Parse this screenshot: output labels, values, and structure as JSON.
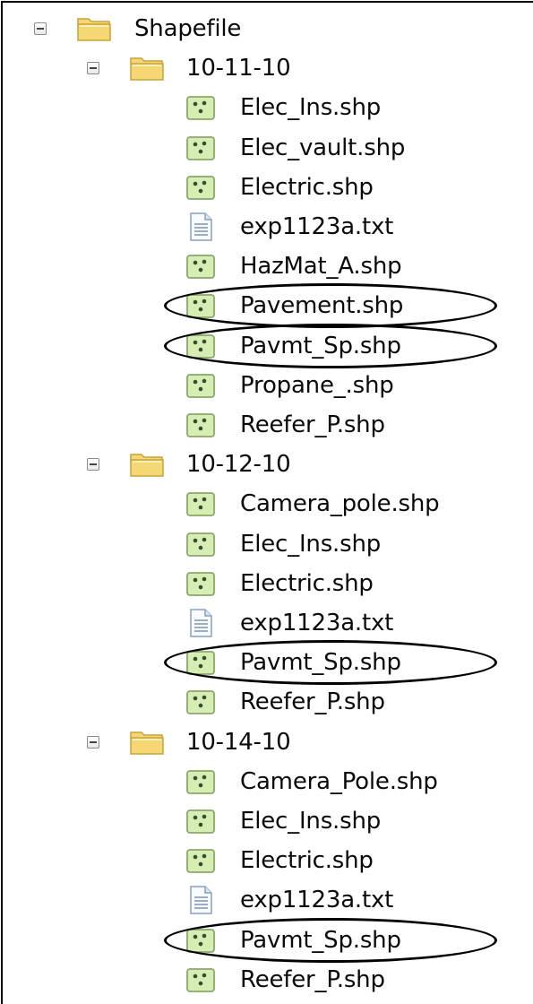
{
  "tree": {
    "root": {
      "label": "Shapefile",
      "icon": "folder-icon",
      "expanded": true
    },
    "folders": [
      {
        "label": "10-11-10",
        "icon": "folder-icon",
        "expanded": true,
        "files": [
          {
            "label": "Elec_Ins.shp",
            "type": "shapefile",
            "icon": "point-shapefile-icon",
            "circled": false
          },
          {
            "label": "Elec_vault.shp",
            "type": "shapefile",
            "icon": "point-shapefile-icon",
            "circled": false
          },
          {
            "label": "Electric.shp",
            "type": "shapefile",
            "icon": "point-shapefile-icon",
            "circled": false
          },
          {
            "label": "exp1123a.txt",
            "type": "text",
            "icon": "text-file-icon",
            "circled": false
          },
          {
            "label": "HazMat_A.shp",
            "type": "shapefile",
            "icon": "point-shapefile-icon",
            "circled": false
          },
          {
            "label": "Pavement.shp",
            "type": "shapefile",
            "icon": "point-shapefile-icon",
            "circled": true
          },
          {
            "label": "Pavmt_Sp.shp",
            "type": "shapefile",
            "icon": "point-shapefile-icon",
            "circled": true
          },
          {
            "label": "Propane_.shp",
            "type": "shapefile",
            "icon": "point-shapefile-icon",
            "circled": false
          },
          {
            "label": "Reefer_P.shp",
            "type": "shapefile",
            "icon": "point-shapefile-icon",
            "circled": false
          }
        ]
      },
      {
        "label": "10-12-10",
        "icon": "folder-icon",
        "expanded": true,
        "files": [
          {
            "label": "Camera_pole.shp",
            "type": "shapefile",
            "icon": "point-shapefile-icon",
            "circled": false
          },
          {
            "label": "Elec_Ins.shp",
            "type": "shapefile",
            "icon": "point-shapefile-icon",
            "circled": false
          },
          {
            "label": "Electric.shp",
            "type": "shapefile",
            "icon": "point-shapefile-icon",
            "circled": false
          },
          {
            "label": "exp1123a.txt",
            "type": "text",
            "icon": "text-file-icon",
            "circled": false
          },
          {
            "label": "Pavmt_Sp.shp",
            "type": "shapefile",
            "icon": "point-shapefile-icon",
            "circled": true
          },
          {
            "label": "Reefer_P.shp",
            "type": "shapefile",
            "icon": "point-shapefile-icon",
            "circled": false
          }
        ]
      },
      {
        "label": "10-14-10",
        "icon": "folder-icon",
        "expanded": true,
        "files": [
          {
            "label": "Camera_Pole.shp",
            "type": "shapefile",
            "icon": "point-shapefile-icon",
            "circled": false
          },
          {
            "label": "Elec_Ins.shp",
            "type": "shapefile",
            "icon": "point-shapefile-icon",
            "circled": false
          },
          {
            "label": "Electric.shp",
            "type": "shapefile",
            "icon": "point-shapefile-icon",
            "circled": false
          },
          {
            "label": "exp1123a.txt",
            "type": "text",
            "icon": "text-file-icon",
            "circled": false
          },
          {
            "label": "Pavmt_Sp.shp",
            "type": "shapefile",
            "icon": "point-shapefile-icon",
            "circled": true
          },
          {
            "label": "Reefer_P.shp",
            "type": "shapefile",
            "icon": "point-shapefile-icon",
            "circled": false
          }
        ]
      }
    ]
  },
  "colors": {
    "folder_fill": "#f5d873",
    "folder_edge": "#c9a43a",
    "shapefile_fill": "#d6edb4",
    "shapefile_edge": "#8aa86a",
    "annotation": "#000000"
  }
}
